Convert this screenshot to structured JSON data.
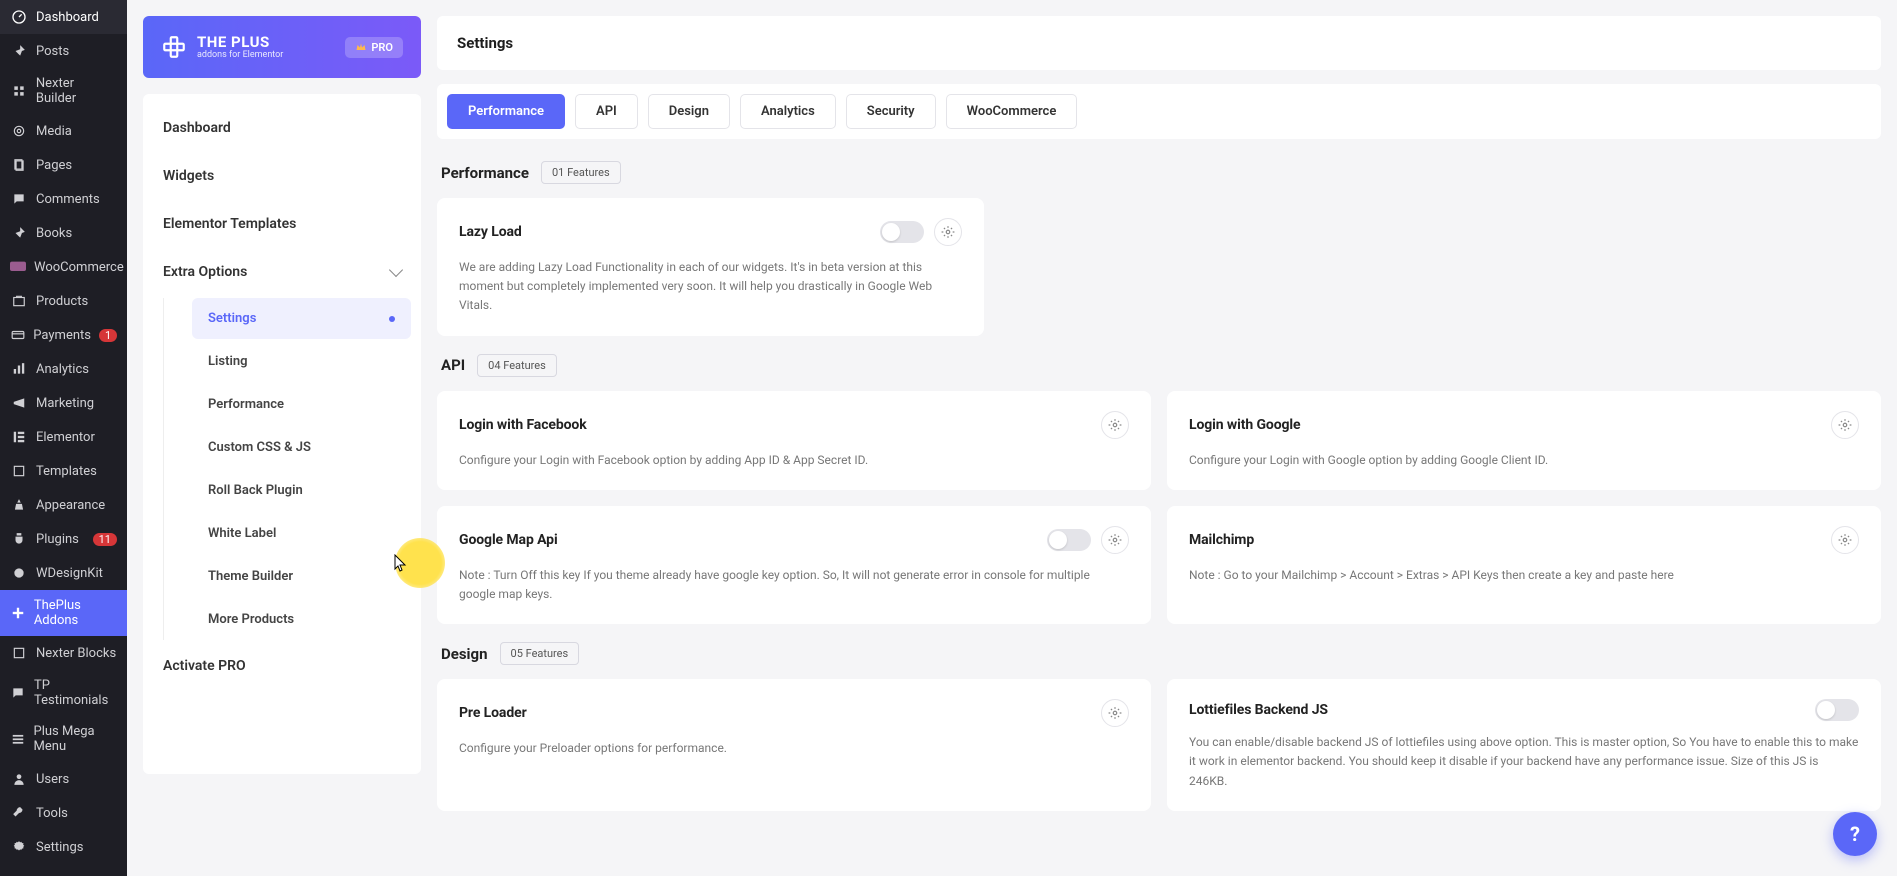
{
  "wp_menu": [
    {
      "icon": "speed",
      "label": "Dashboard"
    },
    {
      "icon": "pin",
      "label": "Posts"
    },
    {
      "icon": "nexter",
      "label": "Nexter Builder"
    },
    {
      "icon": "media",
      "label": "Media"
    },
    {
      "icon": "page",
      "label": "Pages"
    },
    {
      "icon": "comment",
      "label": "Comments"
    },
    {
      "icon": "book",
      "label": "Books"
    },
    {
      "icon": "woo",
      "label": "WooCommerce"
    },
    {
      "icon": "product",
      "label": "Products"
    },
    {
      "icon": "payment",
      "label": "Payments",
      "badge": "1"
    },
    {
      "icon": "bar",
      "label": "Analytics"
    },
    {
      "icon": "marketing",
      "label": "Marketing"
    },
    {
      "icon": "elementor",
      "label": "Elementor"
    },
    {
      "icon": "template",
      "label": "Templates"
    },
    {
      "icon": "appearance",
      "label": "Appearance"
    },
    {
      "icon": "plugin",
      "label": "Plugins",
      "badge": "11"
    },
    {
      "icon": "wdk",
      "label": "WDesignKit"
    },
    {
      "icon": "theplus",
      "label": "ThePlus Addons",
      "active": true
    },
    {
      "icon": "block",
      "label": "Nexter Blocks"
    },
    {
      "icon": "tptest",
      "label": "TP Testimonials"
    },
    {
      "icon": "mega",
      "label": "Plus Mega Menu"
    },
    {
      "icon": "user",
      "label": "Users"
    },
    {
      "icon": "tool",
      "label": "Tools"
    },
    {
      "icon": "settings",
      "label": "Settings"
    }
  ],
  "brand": {
    "title": "THE PLUS",
    "sub": "addons for Elementor",
    "pro": "PRO"
  },
  "plugin_nav": {
    "items": [
      "Dashboard",
      "Widgets",
      "Elementor Templates",
      "Extra Options"
    ],
    "sub": [
      "Settings",
      "Listing",
      "Performance",
      "Custom CSS & JS",
      "Roll Back Plugin",
      "White Label",
      "Theme Builder",
      "More Products"
    ],
    "activate": "Activate PRO"
  },
  "page": {
    "title": "Settings"
  },
  "tabs": [
    "Performance",
    "API",
    "Design",
    "Analytics",
    "Security",
    "WooCommerce"
  ],
  "sections": {
    "performance": {
      "title": "Performance",
      "count": "01 Features"
    },
    "api": {
      "title": "API",
      "count": "04 Features"
    },
    "design": {
      "title": "Design",
      "count": "05 Features"
    }
  },
  "cards": {
    "lazy": {
      "title": "Lazy Load",
      "desc": "We are adding Lazy Load Functionality in each of our widgets. It's in beta version at this moment but completely implemented very soon. It will help you drastically in Google Web Vitals."
    },
    "fb": {
      "title": "Login with Facebook",
      "desc": "Configure your Login with Facebook option by adding App ID & App Secret ID."
    },
    "google": {
      "title": "Login with Google",
      "desc": "Configure your Login with Google option by adding Google Client ID."
    },
    "gmap": {
      "title": "Google Map Api",
      "desc": "Note : Turn Off this key If you theme already have google key option. So, It will not generate error in console for multiple google map keys."
    },
    "mailchimp": {
      "title": "Mailchimp",
      "desc": "Note : Go to your Mailchimp > Account > Extras > API Keys then create a key and paste here"
    },
    "preloader": {
      "title": "Pre Loader",
      "desc": "Configure your Preloader options for performance."
    },
    "lottie": {
      "title": "Lottiefiles Backend JS",
      "desc": "You can enable/disable backend JS of lottiefiles using above option. This is master option, So You have to enable this to make it work in elementor backend. You should keep it disable if your backend have any performance issue. Size of this JS is 246KB."
    }
  },
  "help": "?"
}
